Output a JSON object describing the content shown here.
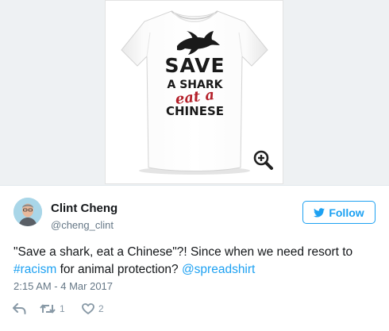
{
  "media": {
    "shirt_text": {
      "line1": "SAVE",
      "line2": "A SHARK",
      "line3": "eat a",
      "line4": "CHINESE"
    },
    "icons": [
      "shark-icon",
      "zoom-in-icon"
    ],
    "colors": {
      "shirt_text": "#1a1a1a",
      "shirt_script": "#b4202a",
      "shirt": "#ffffff"
    }
  },
  "author": {
    "display_name": "Clint Cheng",
    "handle": "@cheng_clint",
    "avatar_icon": "avatar"
  },
  "follow_button": {
    "label": "Follow",
    "icon": "twitter-bird-icon",
    "color": "#1da1f2"
  },
  "tweet": {
    "line1": "\"Save a shark, eat a Chinese\"?! Since when we need resort to",
    "hashtag": "#racism",
    "line2_middle": " for animal protection? ",
    "mention": "@spreadshirt",
    "timestamp": "2:15 AM - 4 Mar 2017"
  },
  "actions": {
    "reply_icon": "reply-icon",
    "retweet_icon": "retweet-icon",
    "retweet_count": "1",
    "like_icon": "heart-icon",
    "like_count": "2"
  }
}
